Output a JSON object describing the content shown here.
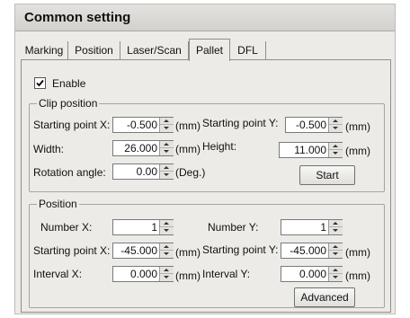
{
  "window": {
    "title": "Common setting"
  },
  "tabs": [
    {
      "label": "Marking",
      "active": false
    },
    {
      "label": "Position",
      "active": false
    },
    {
      "label": "Laser/Scan",
      "active": false
    },
    {
      "label": "Pallet",
      "active": true
    },
    {
      "label": "DFL",
      "active": false
    }
  ],
  "enable": {
    "label": "Enable",
    "checked": true
  },
  "clip_position": {
    "title": "Clip position",
    "starting_x": {
      "label": "Starting point X:",
      "value": "-0.500",
      "unit": "(mm)"
    },
    "starting_y": {
      "label": "Starting point Y:",
      "value": "-0.500",
      "unit": "(mm)"
    },
    "width": {
      "label": "Width:",
      "value": "26.000",
      "unit": "(mm)"
    },
    "height": {
      "label": "Height:",
      "value": "11.000",
      "unit": "(mm)"
    },
    "rotation": {
      "label": "Rotation angle:",
      "value": "0.00",
      "unit": "(Deg.)"
    },
    "start_button": "Start"
  },
  "position": {
    "title": "Position",
    "number_x": {
      "label": "Number X:",
      "value": "1"
    },
    "number_y": {
      "label": "Number Y:",
      "value": "1"
    },
    "starting_x": {
      "label": "Starting point X:",
      "value": "-45.000",
      "unit": "(mm)"
    },
    "starting_y": {
      "label": "Starting point Y:",
      "value": "-45.000",
      "unit": "(mm)"
    },
    "interval_x": {
      "label": "Interval X:",
      "value": "0.000",
      "unit": "(mm)"
    },
    "interval_y": {
      "label": "Interval Y:",
      "value": "0.000",
      "unit": "(mm)"
    },
    "advanced_button": "Advanced"
  }
}
